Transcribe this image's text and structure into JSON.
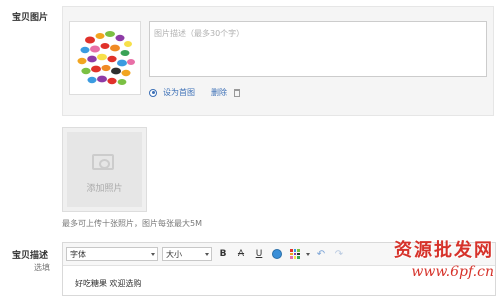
{
  "section": {
    "photos_label": "宝贝图片",
    "description_label": "宝贝描述",
    "optional_label": "选填"
  },
  "photo_item": {
    "desc_placeholder": "图片描述（最多30个字）",
    "set_cover_label": "设为首图",
    "delete_label": "删除"
  },
  "add_photo": {
    "label": "添加照片"
  },
  "hint_text": "最多可上传十张照片，图片每张最大5M",
  "editor": {
    "font_select": "字体",
    "size_select": "大小",
    "bold_label": "B",
    "strike_label": "A",
    "underline_label": "U",
    "content": "好吃糖果 欢迎选购"
  },
  "watermark": {
    "title": "资源批发网",
    "url": "www.6pf.cn"
  },
  "icons": [
    "radio-selected-icon",
    "trash-icon",
    "camera-icon",
    "globe-icon",
    "color-palette-icon",
    "undo-icon",
    "redo-icon"
  ],
  "colors": {
    "link": "#3b6fb6",
    "watermark": "#d6322a"
  }
}
